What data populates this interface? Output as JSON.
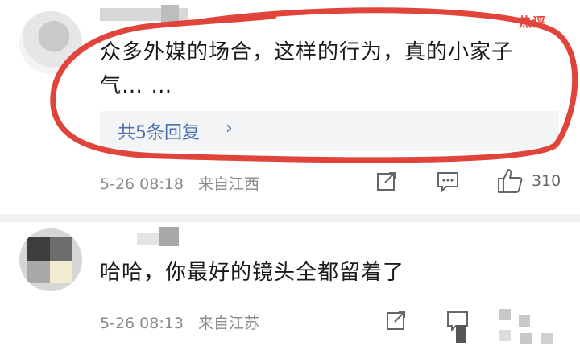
{
  "comments": [
    {
      "text": "众多外媒的场合，这样的行为，真的小家子气… …",
      "hot_label": "热评",
      "reply_summary": "共5条回复",
      "time": "5-26 08:18",
      "location": "来自江西",
      "likes": "310"
    },
    {
      "text": "哈哈，你最好的镜头全都留着了",
      "time": "5-26 08:13",
      "location": "来自江苏"
    }
  ],
  "colors": {
    "link": "#4a6ea9",
    "highlight_ring": "#e0443a",
    "meta": "#8a8a8a"
  },
  "icons": [
    "share-icon",
    "comment-icon",
    "like-icon",
    "chevron-right-icon"
  ]
}
